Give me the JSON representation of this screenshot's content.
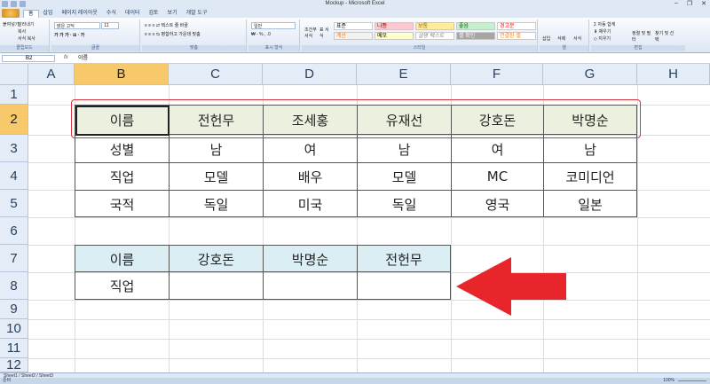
{
  "window": {
    "title": "Mockup - Microsoft Excel",
    "controls": [
      "–",
      "❐",
      "✕"
    ]
  },
  "ribbon_tabs": [
    "홈",
    "삽입",
    "페이지 레이아웃",
    "수식",
    "데이터",
    "검토",
    "보기",
    "개발 도구"
  ],
  "ribbon": {
    "clipboard": {
      "name": "클립보드",
      "paste": "붙여넣기",
      "cut": "잘라내기",
      "copy": "복사",
      "format_painter": "서식 복사"
    },
    "font": {
      "name": "글꼴",
      "font_family": "맑은 고딕",
      "font_size": "11"
    },
    "alignment": {
      "name": "맞춤",
      "wrap": "텍스트 줄 바꿈",
      "merge": "병합하고 가운데 맞춤"
    },
    "number": {
      "name": "표시 형식",
      "format": "일반"
    },
    "styles": {
      "name": "스타일",
      "conditional": "조건부 서식",
      "table": "표 서식",
      "cell_styles": [
        "표준",
        "나쁨",
        "보통",
        "좋음",
        "경고문",
        "계산",
        "메모",
        "설명 텍스트",
        "셀 확인",
        "연결된 셀"
      ]
    },
    "cells": {
      "name": "셀",
      "insert": "삽입",
      "delete": "삭제",
      "format": "서식"
    },
    "editing": {
      "name": "편집",
      "autosum": "자동 합계",
      "fill": "채우기",
      "clear": "지우기",
      "sort": "정렬 및 필터",
      "find": "찾기 및 선택"
    }
  },
  "formula_bar": {
    "name_box": "B2",
    "fx": "fx",
    "formula": "이름"
  },
  "columns": [
    "A",
    "B",
    "C",
    "D",
    "E",
    "F",
    "G",
    "H"
  ],
  "selected_column": "B",
  "rows": [
    "1",
    "2",
    "3",
    "4",
    "5",
    "6",
    "7",
    "8",
    "9",
    "10",
    "11",
    "12"
  ],
  "selected_row": "2",
  "table1": {
    "header": [
      "이름",
      "전헌무",
      "조세홍",
      "유재선",
      "강호돈",
      "박명순"
    ],
    "rows": [
      [
        "성별",
        "남",
        "여",
        "남",
        "여",
        "남"
      ],
      [
        "직업",
        "모델",
        "배우",
        "모델",
        "MC",
        "코미디언"
      ],
      [
        "국적",
        "독일",
        "미국",
        "독일",
        "영국",
        "일본"
      ]
    ],
    "header_fill": "#ebf1de"
  },
  "table2": {
    "header": [
      "이름",
      "강호돈",
      "박명순",
      "전헌무"
    ],
    "rows": [
      [
        "직업",
        "",
        "",
        ""
      ]
    ],
    "header_fill": "#daeef3"
  },
  "annotations": {
    "frame_color": "#d6333a",
    "arrow_color": "#e8252b"
  },
  "sheet_tabs": "Sheet1 / Sheet2 / Sheet3",
  "status": {
    "ready": "준비",
    "zoom": "100%"
  }
}
